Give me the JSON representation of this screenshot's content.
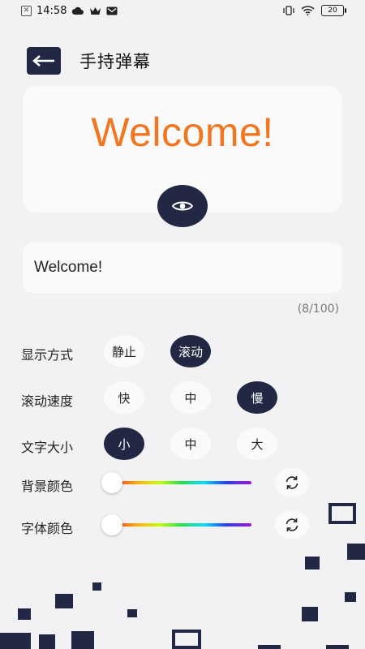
{
  "status_bar": {
    "time": "14:58",
    "battery": "20"
  },
  "header": {
    "title": "手持弹幕"
  },
  "preview": {
    "text": "Welcome!",
    "text_color": "#f07622"
  },
  "input": {
    "value": "Welcome!",
    "char_count": "(8/100)"
  },
  "display_mode": {
    "label": "显示方式",
    "options": [
      "静止",
      "滚动"
    ],
    "selected": "滚动"
  },
  "scroll_speed": {
    "label": "滚动速度",
    "options": [
      "快",
      "中",
      "慢"
    ],
    "selected": "慢"
  },
  "text_size": {
    "label": "文字大小",
    "options": [
      "小",
      "中",
      "大"
    ],
    "selected": "小"
  },
  "background_color": {
    "label": "背景颜色"
  },
  "font_color": {
    "label": "字体颜色"
  },
  "colors": {
    "accent": "#222843",
    "page_bg": "#f2f2f4",
    "card_bg": "#fafafa"
  },
  "icons": [
    "close-box-icon",
    "cloud-icon",
    "crown-icon",
    "mail-icon",
    "vibrate-icon",
    "wifi-icon",
    "battery-icon",
    "back-arrow-icon",
    "eye-icon",
    "refresh-icon"
  ]
}
